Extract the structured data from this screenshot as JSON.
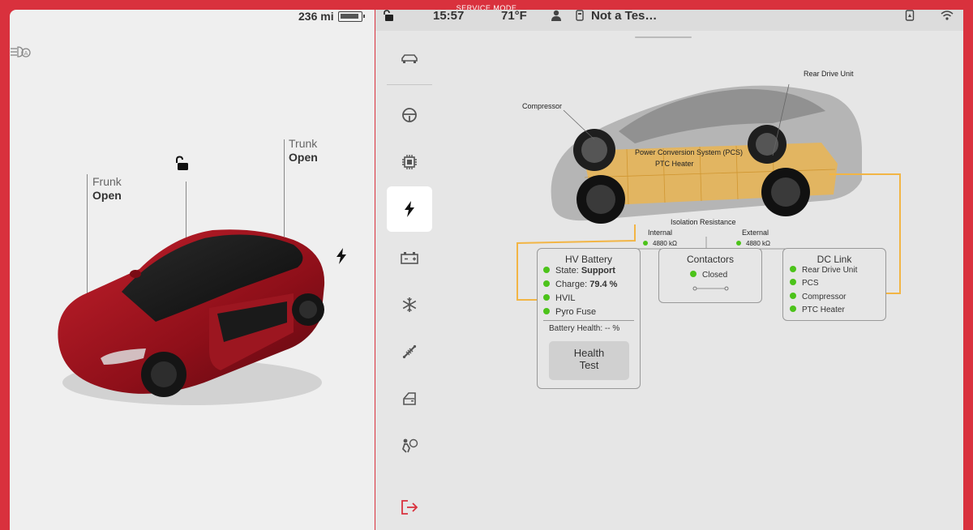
{
  "frame": {
    "label": "SERVICE MODE"
  },
  "left": {
    "range": "236 mi",
    "frunk": {
      "title": "Frunk",
      "value": "Open"
    },
    "trunk": {
      "title": "Trunk",
      "value": "Open"
    },
    "icons": {
      "auto_lights": "auto-headlights-icon",
      "lock": "unlocked-icon",
      "charge": "lightning-icon"
    }
  },
  "status": {
    "time": "15:57",
    "temperature": "71°F",
    "profile": "Not a Tes…"
  },
  "sidebar": {
    "items": [
      {
        "name": "car-icon",
        "glyph": "🚘"
      },
      {
        "name": "steering-wheel-icon",
        "glyph": "◎"
      },
      {
        "name": "chip-icon",
        "glyph": "▣"
      },
      {
        "name": "high-voltage-icon",
        "glyph": "⚡"
      },
      {
        "name": "battery-icon",
        "glyph": "⊞"
      },
      {
        "name": "snowflake-icon",
        "glyph": "❄"
      },
      {
        "name": "shock-absorber-icon",
        "glyph": "⚒"
      },
      {
        "name": "door-icon",
        "glyph": "◪"
      },
      {
        "name": "airbag-icon",
        "glyph": "✲"
      },
      {
        "name": "exit-icon",
        "glyph": "⇥"
      }
    ],
    "active_index": 3
  },
  "diagram": {
    "labels": {
      "compressor": "Compressor",
      "rear_drive_unit": "Rear Drive Unit",
      "pcs": "Power Conversion System (PCS)",
      "ptc_heater": "PTC Heater",
      "isolation_resistance": "Isolation Resistance",
      "internal": "Internal",
      "internal_value": "4880 kΩ",
      "external": "External",
      "external_value": "4880 kΩ"
    },
    "hv_battery": {
      "title": "HV Battery",
      "state_label": "State:",
      "state_value": "Support",
      "charge_label": "Charge:",
      "charge_value": "79.4 %",
      "hvil": "HVIL",
      "pyro_fuse": "Pyro Fuse",
      "battery_health": "Battery Health: -- %",
      "health_test_line1": "Health",
      "health_test_line2": "Test"
    },
    "contactors": {
      "title": "Contactors",
      "status": "Closed"
    },
    "dc_link": {
      "title": "DC Link",
      "items": [
        "Rear Drive Unit",
        "PCS",
        "Compressor",
        "PTC Heater"
      ]
    },
    "colors": {
      "active": "#4cc31a",
      "hv_path": "#f2b545",
      "frame": "#d9313d"
    }
  }
}
